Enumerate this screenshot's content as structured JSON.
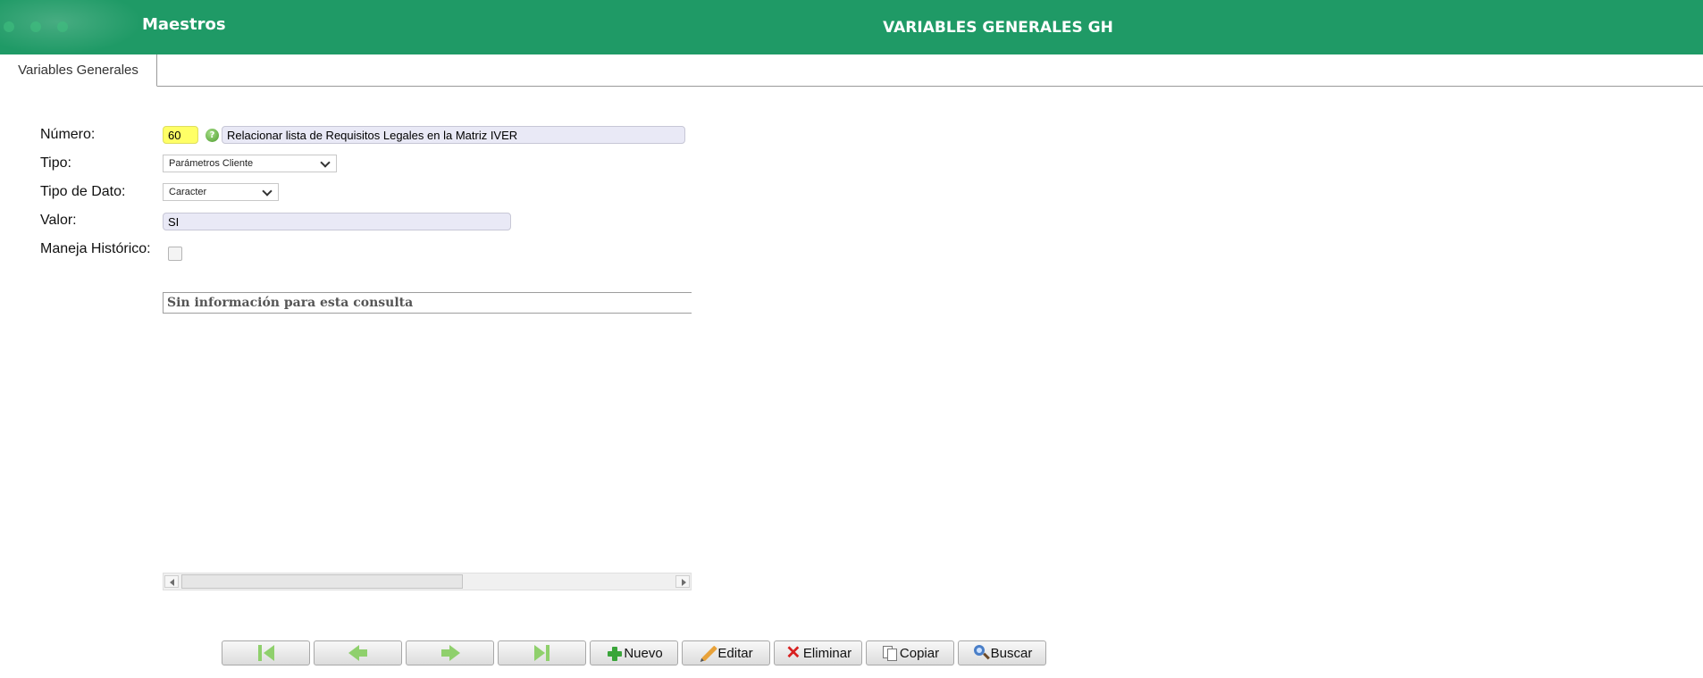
{
  "header": {
    "app_title": "Maestros",
    "page_title": "VARIABLES GENERALES GH",
    "color": "#1f9a66"
  },
  "tabs": [
    {
      "label": "Variables Generales",
      "active": true
    }
  ],
  "form": {
    "numero": {
      "label": "Número:",
      "value": "60",
      "description": "Relacionar lista de Requisitos Legales en la Matriz IVER",
      "help_icon": "help-icon"
    },
    "tipo": {
      "label": "Tipo:",
      "value": "Parámetros Cliente"
    },
    "tipo_dato": {
      "label": "Tipo de Dato:",
      "value": "Caracter"
    },
    "valor": {
      "label": "Valor:",
      "value": "SI"
    },
    "maneja_historico": {
      "label": "Maneja Histórico:",
      "checked": false
    }
  },
  "grid": {
    "message": "Sin información para esta consulta"
  },
  "toolbar": {
    "first_icon": "first-record-icon",
    "prev_icon": "previous-record-icon",
    "next_icon": "next-record-icon",
    "last_icon": "last-record-icon",
    "nuevo": "Nuevo",
    "editar": "Editar",
    "eliminar": "Eliminar",
    "copiar": "Copiar",
    "buscar": "Buscar"
  }
}
